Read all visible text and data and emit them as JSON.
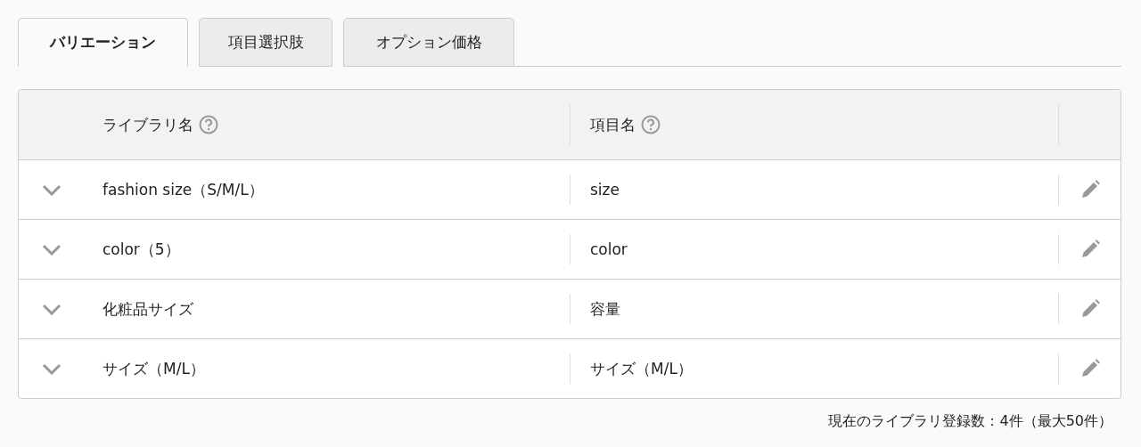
{
  "tabs": [
    {
      "label": "バリエーション",
      "selected": true
    },
    {
      "label": "項目選択肢",
      "selected": false
    },
    {
      "label": "オプション価格",
      "selected": false
    }
  ],
  "table": {
    "columns": [
      "ライブラリ名",
      "項目名"
    ],
    "rows": [
      {
        "library": "fashion size（S/M/L）",
        "item": "size"
      },
      {
        "library": "color（5）",
        "item": "color"
      },
      {
        "library": "化粧品サイズ",
        "item": "容量"
      },
      {
        "library": "サイズ（M/L）",
        "item": "サイズ（M/L）"
      }
    ]
  },
  "footer": "現在のライブラリ登録数：4件（最大50件）"
}
